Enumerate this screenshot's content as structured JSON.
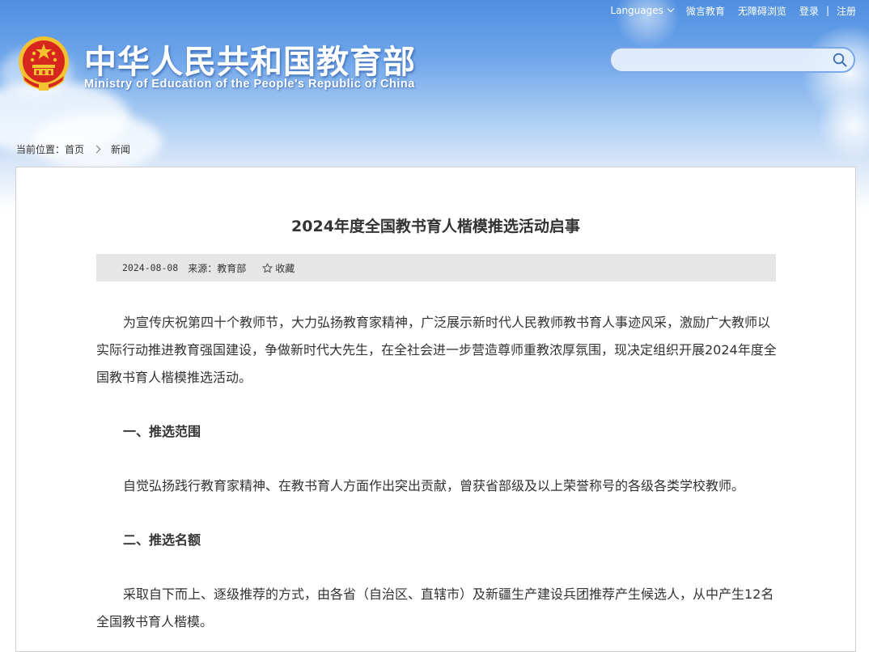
{
  "header": {
    "title": "中华人民共和国教育部",
    "subtitle": "Ministry of Education of the People's Republic of China",
    "top_links": {
      "languages": "Languages",
      "weiyan": "微言教育",
      "accessible": "无障碍浏览",
      "login": "登录",
      "separator": "|",
      "register": "注册"
    },
    "search": {
      "placeholder": ""
    }
  },
  "breadcrumb": {
    "prefix": "当前位置：",
    "home": "首页",
    "current": "新闻"
  },
  "article": {
    "title": "2024年度全国教书育人楷模推选活动启事",
    "meta": {
      "date": "2024-08-08",
      "source": "来源：教育部",
      "favorite": "收藏"
    },
    "paragraphs": {
      "intro": "为宣传庆祝第四十个教师节，大力弘扬教育家精神，广泛展示新时代人民教师教书育人事迹风采，激励广大教师以实际行动推进教育强国建设，争做新时代大先生，在全社会进一步营造尊师重教浓厚氛围，现决定组织开展2024年度全国教书育人楷模推选活动。",
      "h1": "一、推选范围",
      "p1": "自觉弘扬践行教育家精神、在教书育人方面作出突出贡献，曾获省部级及以上荣誉称号的各级各类学校教师。",
      "h2": "二、推选名额",
      "p2": "采取自下而上、逐级推荐的方式，由各省（自治区、直辖市）及新疆生产建设兵团推荐产生候选人，从中产生12名全国教书育人楷模。"
    }
  },
  "colors": {
    "header_blue": "#4f8fe0",
    "text": "#333333",
    "meta_bar": "#e6e6e6",
    "emblem_red": "#d7261e",
    "emblem_gold": "#f2c230"
  }
}
